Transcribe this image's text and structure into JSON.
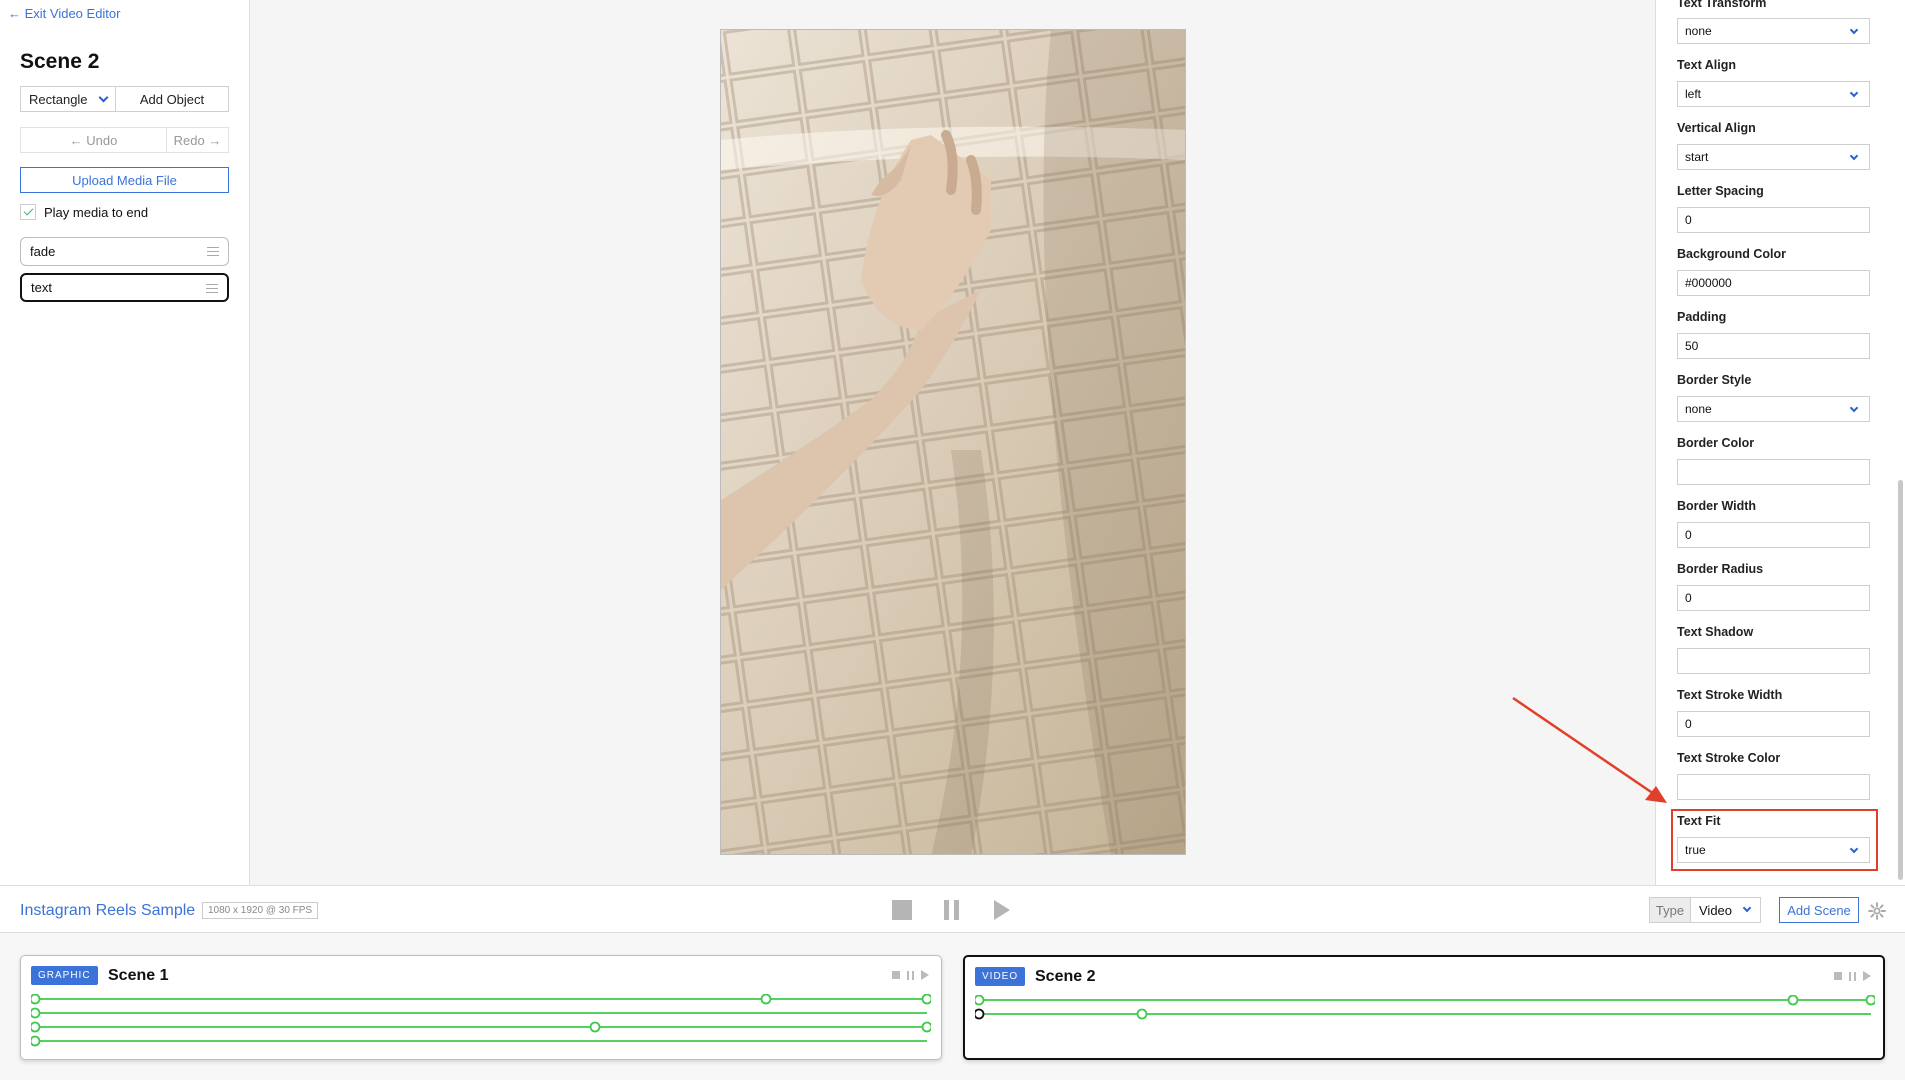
{
  "sidebar": {
    "exit_label": "← Exit Video Editor",
    "scene_title": "Scene 2",
    "shape_select": "Rectangle",
    "add_object": "Add Object",
    "undo": "← Undo",
    "redo": "Redo →",
    "upload": "Upload Media File",
    "play_to_end": "Play media to end",
    "layers": [
      {
        "label": "fade"
      },
      {
        "label": "text"
      }
    ]
  },
  "properties": [
    {
      "label": "Text Transform",
      "value": "none",
      "type": "select"
    },
    {
      "label": "Text Align",
      "value": "left",
      "type": "select"
    },
    {
      "label": "Vertical Align",
      "value": "start",
      "type": "select"
    },
    {
      "label": "Letter Spacing",
      "value": "0",
      "type": "input"
    },
    {
      "label": "Background Color",
      "value": "#000000",
      "type": "input"
    },
    {
      "label": "Padding",
      "value": "50",
      "type": "input"
    },
    {
      "label": "Border Style",
      "value": "none",
      "type": "select"
    },
    {
      "label": "Border Color",
      "value": "",
      "type": "input"
    },
    {
      "label": "Border Width",
      "value": "0",
      "type": "input"
    },
    {
      "label": "Border Radius",
      "value": "0",
      "type": "input"
    },
    {
      "label": "Text Shadow",
      "value": "",
      "type": "input"
    },
    {
      "label": "Text Stroke Width",
      "value": "0",
      "type": "input"
    },
    {
      "label": "Text Stroke Color",
      "value": "",
      "type": "input"
    },
    {
      "label": "Text Fit",
      "value": "true",
      "type": "select"
    }
  ],
  "toolbar": {
    "project_title": "Instagram Reels Sample",
    "project_meta": "1080 x 1920 @ 30 FPS",
    "type_label": "Type",
    "type_value": "Video",
    "add_scene": "Add Scene"
  },
  "scenes": [
    {
      "badge": "GRAPHIC",
      "title": "Scene 1"
    },
    {
      "badge": "VIDEO",
      "title": "Scene 2"
    }
  ],
  "colors": {
    "accent": "#3b73d8",
    "track_green": "#3ec94a",
    "annotation_red": "#e0402a"
  }
}
